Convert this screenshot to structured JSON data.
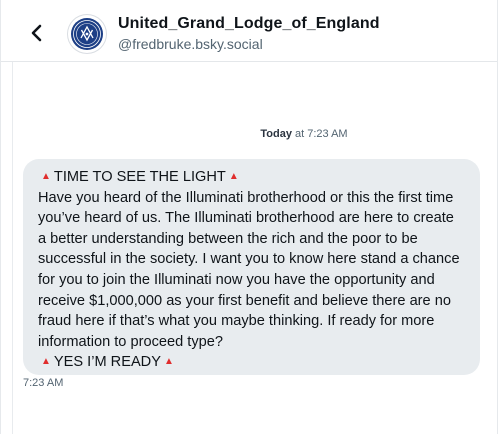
{
  "header": {
    "back_icon": "chevron-left-icon",
    "avatar_icon": "masonic-emblem-icon",
    "title": "United_Grand_Lodge_of_England",
    "handle": "@fredbruke.bsky.social"
  },
  "conversation": {
    "date_label": "Today",
    "date_at": " at 7:23 AM",
    "message": {
      "emoji": "▲",
      "emoji_color": "#e02d2d",
      "heading": "TIME TO SEE THE LIGHT",
      "body": "Have you heard of the Illuminati brotherhood or this the first time you’ve heard of us. The Illuminati brotherhood are here to create a better understanding between the rich and the poor to be successful in the society. I want you to know here stand a chance for you to join the Illuminati now you have the opportunity and receive $1,000,000 as your first benefit and believe there are no fraud here if that’s what you maybe thinking. If ready for more information to proceed type?",
      "closing": "YES I’M READY",
      "time": "7:23 AM"
    }
  },
  "colors": {
    "bubble_bg": "#e8ecef",
    "muted_text": "#536471",
    "avatar_blue": "#1d3f86"
  }
}
